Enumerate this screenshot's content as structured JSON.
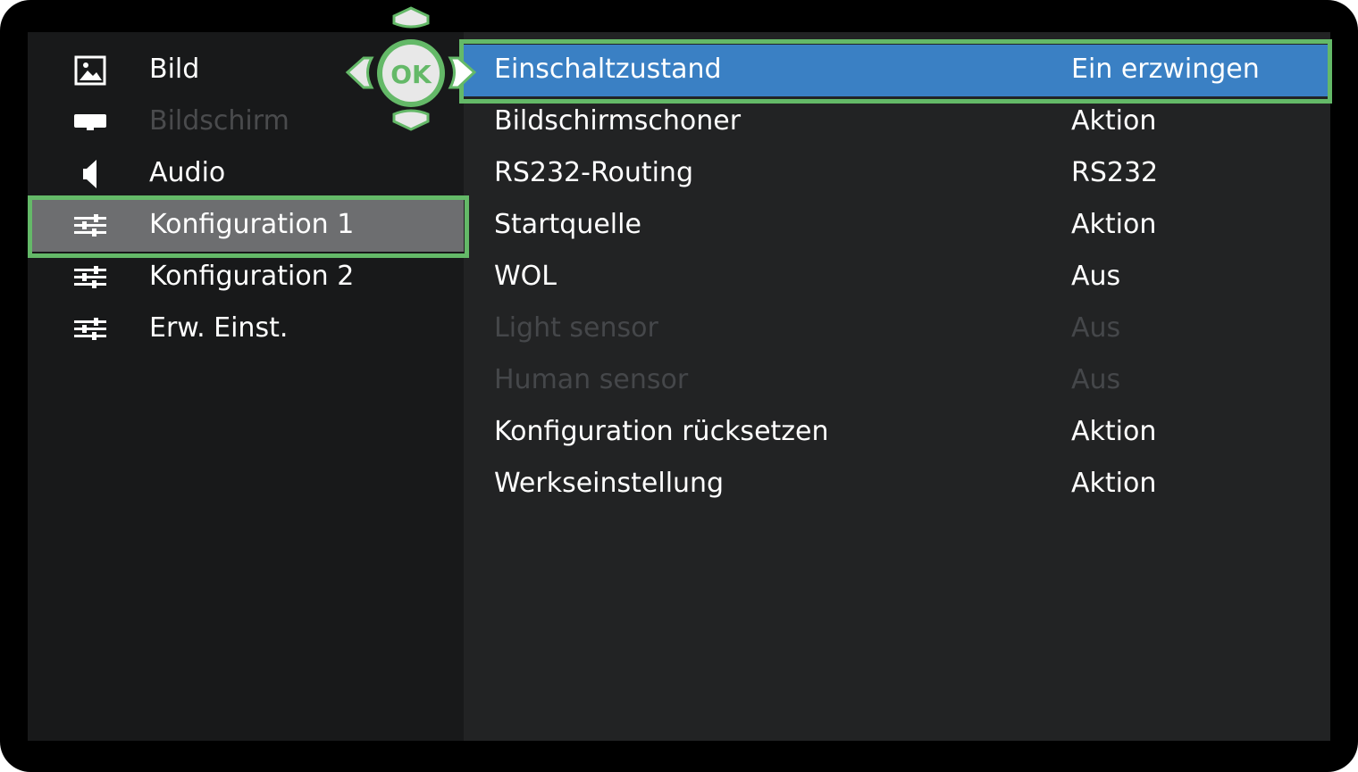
{
  "colors": {
    "highlight_frame": "#64b968",
    "active_row": "#3a80c4",
    "selected_menu": "#6d6e70",
    "left_panel": "#18191a",
    "right_panel": "#222324",
    "dim_text": "#4a4b4d"
  },
  "nav_pad": {
    "ok_label": "OK",
    "icons": [
      "chevron-up-icon",
      "chevron-left-icon",
      "ok-button",
      "chevron-right-icon",
      "chevron-down-icon"
    ]
  },
  "sidebar": {
    "items": [
      {
        "label": "Bild",
        "icon": "picture-icon",
        "state": "normal"
      },
      {
        "label": "Bildschirm",
        "icon": "display-icon",
        "state": "disabled"
      },
      {
        "label": "Audio",
        "icon": "speaker-icon",
        "state": "normal"
      },
      {
        "label": "Konfiguration 1",
        "icon": "sliders-icon",
        "state": "selected"
      },
      {
        "label": "Konfiguration 2",
        "icon": "sliders-icon",
        "state": "normal"
      },
      {
        "label": "Erw. Einst.",
        "icon": "sliders-icon",
        "state": "normal"
      }
    ]
  },
  "settings": {
    "rows": [
      {
        "name": "Einschaltzustand",
        "value": "Ein erzwingen",
        "state": "active"
      },
      {
        "name": "Bildschirmschoner",
        "value": "Aktion",
        "state": "normal"
      },
      {
        "name": "RS232-Routing",
        "value": "RS232",
        "state": "normal"
      },
      {
        "name": "Startquelle",
        "value": "Aktion",
        "state": "normal"
      },
      {
        "name": "WOL",
        "value": "Aus",
        "state": "normal"
      },
      {
        "name": "Light sensor",
        "value": "Aus",
        "state": "disabled"
      },
      {
        "name": "Human sensor",
        "value": "Aus",
        "state": "disabled"
      },
      {
        "name": "Konfiguration rücksetzen",
        "value": "Aktion",
        "state": "normal"
      },
      {
        "name": "Werkseinstellung",
        "value": "Aktion",
        "state": "normal"
      }
    ]
  }
}
